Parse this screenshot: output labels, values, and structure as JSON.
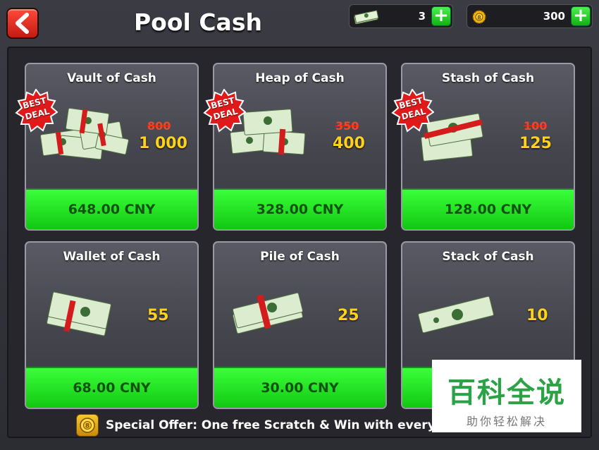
{
  "header": {
    "title": "Pool Cash",
    "cash_count": "3",
    "coin_count": "300",
    "back_icon": "chevron-left-icon"
  },
  "packs": [
    {
      "name": "Vault of Cash",
      "old_amount": "800",
      "amount": "1 000",
      "price": "648.00 CNY",
      "badge": "BEST\nDEAL"
    },
    {
      "name": "Heap of Cash",
      "old_amount": "350",
      "amount": "400",
      "price": "328.00 CNY",
      "badge": "BEST\nDEAL"
    },
    {
      "name": "Stash of Cash",
      "old_amount": "100",
      "amount": "125",
      "price": "128.00 CNY",
      "badge": "BEST\nDEAL"
    },
    {
      "name": "Wallet of Cash",
      "amount": "55",
      "price": "68.00 CNY"
    },
    {
      "name": "Pile of Cash",
      "amount": "25",
      "price": "30.00 CNY"
    },
    {
      "name": "Stack of Cash",
      "amount": "10",
      "price": ""
    }
  ],
  "offer": {
    "text": "Special Offer: One free Scratch & Win with every p"
  },
  "watermark": {
    "title": "百科全说",
    "subtitle": "助你轻松解决"
  },
  "colors": {
    "accent_green": "#22d822",
    "price_text": "#145214",
    "amount_yellow": "#ffd21a",
    "old_amount_red": "#e84a2a",
    "back_red": "#e02a1c"
  }
}
